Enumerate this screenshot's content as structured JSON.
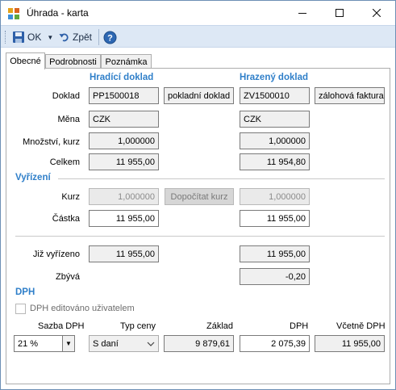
{
  "window": {
    "title": "Úhrada - karta",
    "minimize": "—",
    "maximize": "☐",
    "close": "✕"
  },
  "toolbar": {
    "ok_label": "OK",
    "back_label": "Zpět",
    "help_label": "?"
  },
  "tabs": [
    {
      "label": "Obecné",
      "active": true
    },
    {
      "label": "Podrobnosti",
      "active": false
    },
    {
      "label": "Poznámka",
      "active": false
    }
  ],
  "form": {
    "col_paying": "Hradící doklad",
    "col_paid": "Hrazený doklad",
    "doc_label": "Doklad",
    "doc_paying_number": "PP1500018",
    "doc_paying_type": "pokladní doklad",
    "doc_paid_number": "ZV1500010",
    "doc_paid_type": "zálohová faktura",
    "currency_label": "Měna",
    "currency_paying": "CZK",
    "currency_paid": "CZK",
    "qty_rate_label": "Množství, kurz",
    "qty_rate_paying": "1,000000",
    "qty_rate_paid": "1,000000",
    "total_label": "Celkem",
    "total_paying": "11 955,00",
    "total_paid": "11 954,80"
  },
  "settlement": {
    "section_title": "Vyřízení",
    "rate_label": "Kurz",
    "rate_paying": "1,000000",
    "recalc_button": "Dopočítat kurz",
    "rate_paid": "1,000000",
    "amount_label": "Částka",
    "amount_paying": "11 955,00",
    "amount_paid": "11 955,00",
    "settled_label": "Již vyřízeno",
    "settled_paying": "11 955,00",
    "settled_paid": "11 955,00",
    "remaining_label": "Zbývá",
    "remaining_paid": "-0,20"
  },
  "vat": {
    "section_title": "DPH",
    "edited_checkbox_label": "DPH editováno uživatelem",
    "edited_checked": false,
    "rate_header": "Sazba DPH",
    "price_type_header": "Typ ceny",
    "base_header": "Základ",
    "vat_header": "DPH",
    "incl_header": "Včetně DPH",
    "rate_value": "21 %",
    "price_type_value": "S daní",
    "base_value": "9 879,61",
    "vat_value": "2 075,39",
    "incl_value": "11 955,00"
  },
  "colors": {
    "accent": "#2f7fc9",
    "toolbar_bg": "#dde8f5",
    "readonly_bg": "#f0f0f0"
  }
}
